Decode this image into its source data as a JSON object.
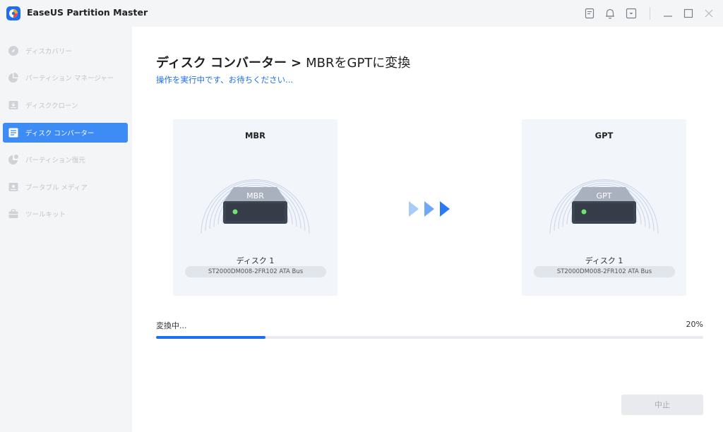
{
  "window": {
    "title": "EaseUS Partition Master",
    "icons": [
      "feedback-icon",
      "bell-icon",
      "dropdown-menu-icon",
      "minimize-icon",
      "maximize-icon",
      "close-icon"
    ]
  },
  "sidebar": {
    "items": [
      {
        "label": "ディスカバリー",
        "icon": "discovery-icon",
        "active": false
      },
      {
        "label": "パーティション マネージャー",
        "icon": "pie-chart-icon",
        "active": false
      },
      {
        "label": "ディスククローン",
        "icon": "disk-clone-icon",
        "active": false
      },
      {
        "label": "ディスク コンバーター",
        "icon": "disk-converter-icon",
        "active": true
      },
      {
        "label": "パーティション復元",
        "icon": "partition-recovery-icon",
        "active": false
      },
      {
        "label": "ブータブル メディア",
        "icon": "bootable-media-icon",
        "active": false
      },
      {
        "label": "ツールキット",
        "icon": "toolkit-icon",
        "active": false
      }
    ]
  },
  "main": {
    "title_main": "ディスク コンバーター",
    "title_sep": ">",
    "title_sub": "MBRをGPTに変換",
    "subtitle": "操作を実行中です、お待ちください...",
    "source": {
      "title": "MBR",
      "badge": "MBR",
      "disk_name": "ディスク 1",
      "model": "ST2000DM008-2FR102 ATA Bus"
    },
    "target": {
      "title": "GPT",
      "badge": "GPT",
      "disk_name": "ディスク 1",
      "model": "ST2000DM008-2FR102 ATA Bus"
    },
    "progress": {
      "label": "変換中...",
      "percent_text": "20%",
      "percent": 20
    },
    "stop_label": "中止"
  },
  "colors": {
    "accent": "#1d6ff2",
    "sidebar_active": "#3d8bf5",
    "card_bg": "#f2f5fa",
    "disk_dark": "#3d4552",
    "led_green": "#6ee36e"
  }
}
